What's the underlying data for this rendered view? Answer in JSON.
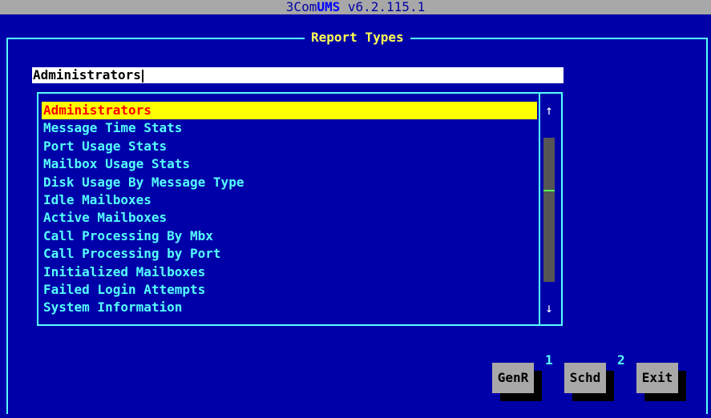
{
  "app": {
    "brand": "3Com",
    "accent": "UMS",
    "version": "v6.2.115.1"
  },
  "dialog": {
    "title": "Report Types"
  },
  "search": {
    "value": "Administrators"
  },
  "list": {
    "items": [
      {
        "label": "Administrators",
        "selected": true
      },
      {
        "label": "Message Time Stats"
      },
      {
        "label": "Port Usage Stats"
      },
      {
        "label": "Mailbox Usage Stats"
      },
      {
        "label": "Disk Usage By Message Type"
      },
      {
        "label": "Idle Mailboxes"
      },
      {
        "label": "Active Mailboxes"
      },
      {
        "label": "Call Processing By Mbx"
      },
      {
        "label": "Call Processing by Port"
      },
      {
        "label": "Initialized Mailboxes"
      },
      {
        "label": "Failed Login Attempts"
      },
      {
        "label": "System Information"
      }
    ]
  },
  "scrollbar": {
    "up_icon": "arrow-up-icon",
    "down_icon": "arrow-down-icon",
    "up_glyph": "↑",
    "down_glyph": "↓"
  },
  "buttons": {
    "genr": {
      "label": "GenR",
      "hotkey": "1"
    },
    "schd": {
      "label": "Schd",
      "hotkey": "2"
    },
    "exit": {
      "label": "Exit"
    }
  },
  "colors": {
    "background": "#0000a8",
    "frame": "#55ffff",
    "title_text": "#ffff55",
    "selected_bg": "#ffff00",
    "selected_text": "#ff0000",
    "button_bg": "#a8a8a8"
  }
}
